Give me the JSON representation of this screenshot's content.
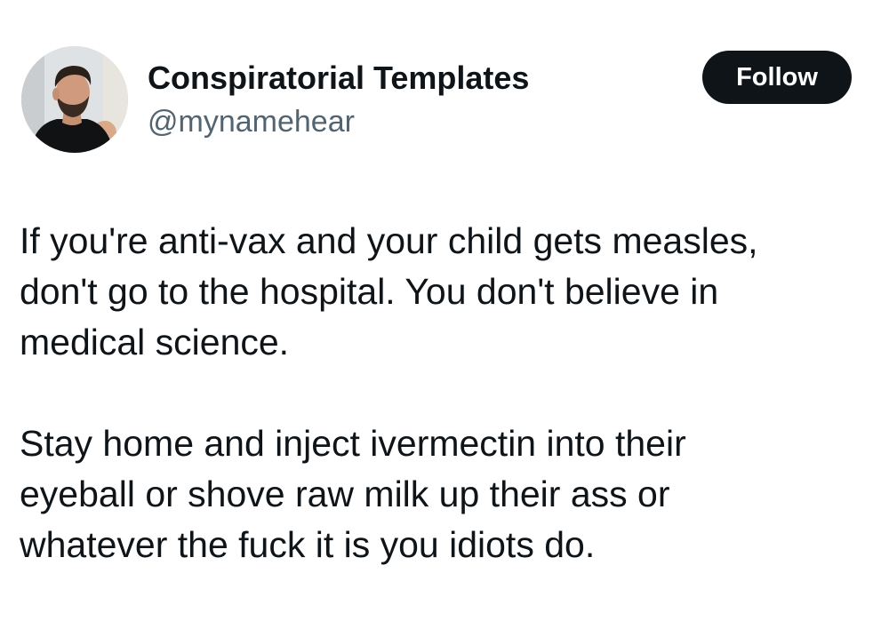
{
  "author": {
    "display_name": "Conspiratorial Templates",
    "handle": "@mynamehear",
    "avatar_icon": "user-avatar-photo"
  },
  "actions": {
    "follow_label": "Follow"
  },
  "tweet": {
    "paragraphs": [
      {
        "lines": [
          "If you're anti-vax and your child gets measles,",
          "don't go to the hospital. You don't believe in",
          "medical science."
        ]
      },
      {
        "lines": [
          "Stay home and inject ivermectin into their",
          "eyeball or shove raw milk up their ass or",
          "whatever the fuck it is you idiots do."
        ]
      }
    ]
  },
  "colors": {
    "text_primary": "#0f1419",
    "text_secondary": "#536471",
    "follow_button_bg": "#0f1419",
    "follow_button_text": "#ffffff",
    "background": "#ffffff"
  }
}
